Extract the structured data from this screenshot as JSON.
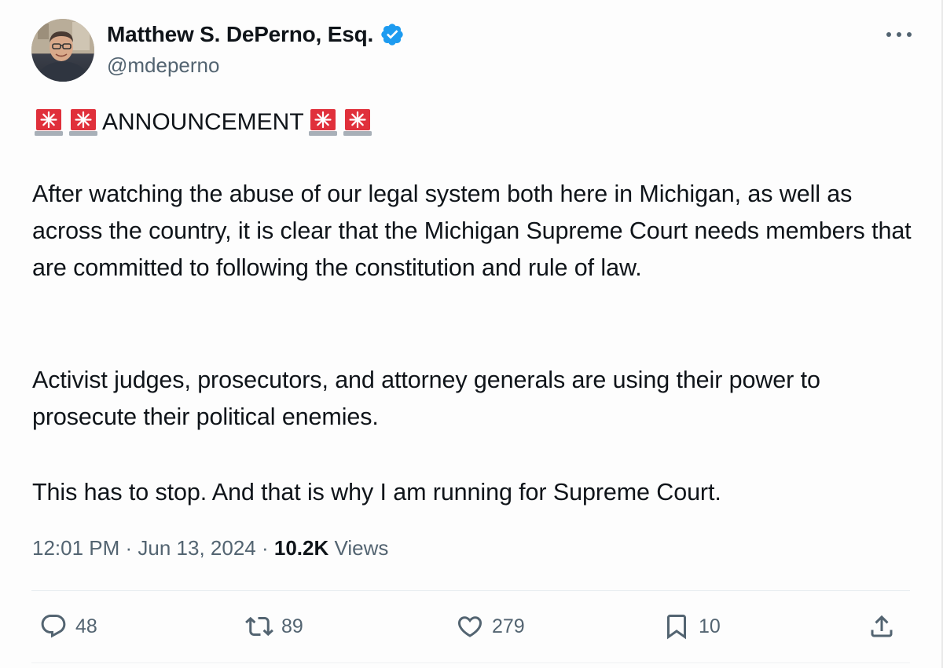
{
  "author": {
    "display_name": "Matthew S. DePerno, Esq.",
    "handle": "@mdeperno",
    "verified": true,
    "verified_color": "#1d9bf0"
  },
  "tweet": {
    "announcement": "ANNOUNCEMENT",
    "siren_icon": "police-car-light",
    "paragraphs": [
      "After watching the abuse of our legal system both here in Michigan, as well as across the country, it is clear that the Michigan Supreme Court needs members that are committed to following the constitution and rule of law.",
      "Activist judges, prosecutors, and attorney generals are using their power to prosecute their political enemies.",
      "This has to stop.  And that is why I am running for Supreme Court."
    ]
  },
  "meta": {
    "time": "12:01 PM",
    "separator": " · ",
    "date": "Jun 13, 2024",
    "views_count": "10.2K",
    "views_label": " Views"
  },
  "actions": {
    "replies": "48",
    "reposts": "89",
    "likes": "279",
    "bookmarks": "10"
  },
  "colors": {
    "text": "#0f1419",
    "secondary": "#536471",
    "siren_red": "#e0303b"
  }
}
